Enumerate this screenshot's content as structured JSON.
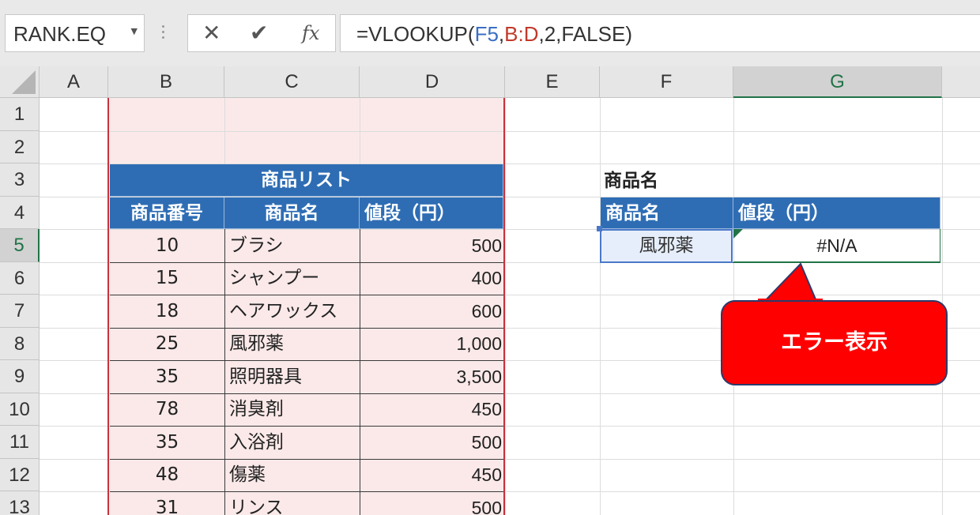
{
  "formula_bar": {
    "name_box": "RANK.EQ",
    "cancel_icon": "✕",
    "enter_icon": "✔",
    "fx_label": "fx",
    "formula_prefix": "=VLOOKUP(",
    "formula_ref1": "F5",
    "formula_sep1": ",",
    "formula_ref2": "B:D",
    "formula_suffix": ",2,FALSE)"
  },
  "columns": [
    "A",
    "B",
    "C",
    "D",
    "E",
    "F",
    "G"
  ],
  "rows": [
    "1",
    "2",
    "3",
    "4",
    "5",
    "6",
    "7",
    "8",
    "9",
    "10",
    "11",
    "12",
    "13"
  ],
  "selected_column": "G",
  "selected_row": "5",
  "product_list": {
    "title": "商品リスト",
    "headers": [
      "商品番号",
      "商品名",
      "値段（円）"
    ],
    "items": [
      {
        "id": "10",
        "name": "ブラシ",
        "price": "500"
      },
      {
        "id": "15",
        "name": "シャンプー",
        "price": "400"
      },
      {
        "id": "18",
        "name": "ヘアワックス",
        "price": "600"
      },
      {
        "id": "25",
        "name": "風邪薬",
        "price": "1,000"
      },
      {
        "id": "35",
        "name": "照明器具",
        "price": "3,500"
      },
      {
        "id": "78",
        "name": "消臭剤",
        "price": "450"
      },
      {
        "id": "35",
        "name": "入浴剤",
        "price": "500"
      },
      {
        "id": "48",
        "name": "傷薬",
        "price": "450"
      },
      {
        "id": "31",
        "name": "リンス",
        "price": "500"
      }
    ]
  },
  "lookup": {
    "label": "商品名",
    "headers": [
      "商品名",
      "値段（円）"
    ],
    "input_value": "風邪薬",
    "result_value": "#N/A"
  },
  "callout": {
    "text": "エラー表示",
    "fill_color": "#ff0000"
  },
  "colors": {
    "header_blue": "#2e6db4",
    "pink_fill": "#fbe9e9",
    "selection_red": "#c8323c",
    "excel_green": "#217346"
  }
}
